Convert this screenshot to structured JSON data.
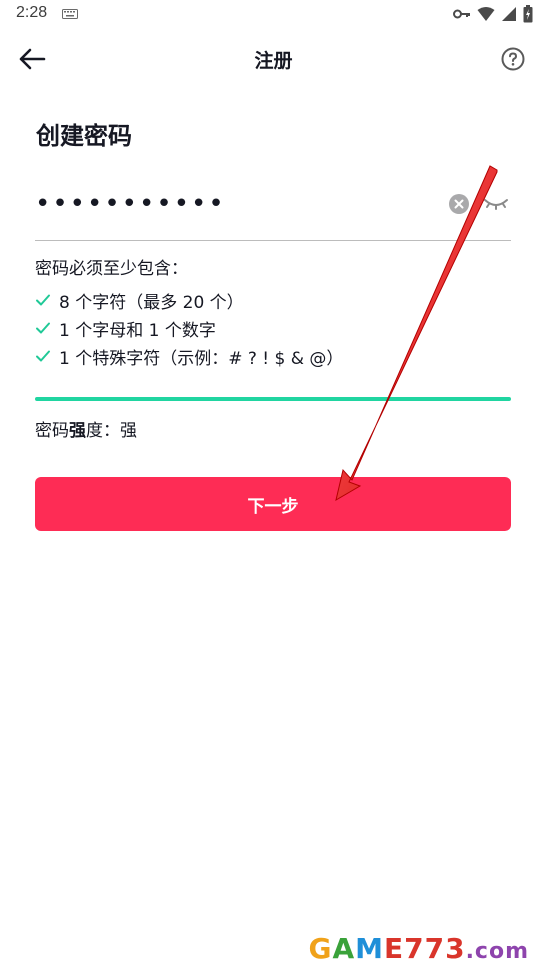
{
  "status_bar": {
    "time": "2:28",
    "icons": [
      "keyboard-icon",
      "key-icon",
      "wifi-icon",
      "signal-icon",
      "battery-icon"
    ]
  },
  "header": {
    "title": "注册",
    "back_icon": "arrow-left-icon",
    "help_icon": "question-circle-icon"
  },
  "page_title": "创建密码",
  "password_field": {
    "value": "•••••••••••",
    "clear_icon": "clear-icon",
    "visibility_icon": "eye-closed-icon"
  },
  "requirements": {
    "heading": "密码必须至少包含：",
    "items": [
      {
        "label": "8 个字符（最多 20 个）",
        "met": true
      },
      {
        "label": "1 个字母和 1 个数字",
        "met": true
      },
      {
        "label": "1 个特殊字符（示例：# ? ! $ & @）",
        "met": true
      }
    ]
  },
  "strength": {
    "label_prefix": "密码",
    "label_bold": "强",
    "label_suffix": "度：",
    "value": "强",
    "level": 1.0,
    "color": "#20d5a1"
  },
  "next_button": {
    "label": "下一步",
    "color": "#fe2c55"
  },
  "watermark": {
    "part1": "G",
    "part2": "A",
    "part3": "M",
    "part4": "E773",
    "part5": ".com"
  }
}
